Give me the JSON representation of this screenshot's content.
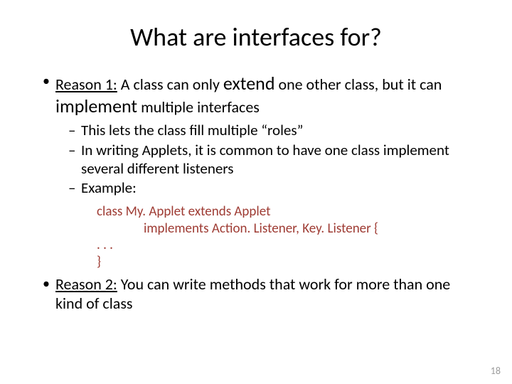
{
  "title": "What are interfaces for?",
  "reason1": {
    "label": "Reason 1:",
    "part1": " A class can only ",
    "extend": "extend",
    "part2": " one other class, but it can ",
    "implement": "implement",
    "part3": " multiple interfaces"
  },
  "sub": {
    "s1": "This lets the class fill multiple “roles”",
    "s2": "In writing Applets, it is common to have one class implement several different listeners",
    "s3": "Example:"
  },
  "code": {
    "l1": "class My. Applet extends Applet",
    "l2": "implements Action. Listener, Key. Listener {",
    "l3": ". . .",
    "l4": "}"
  },
  "reason2": {
    "label": "Reason 2:",
    "text": " You can write methods that work for more than one kind of class"
  },
  "pagenum": "18"
}
